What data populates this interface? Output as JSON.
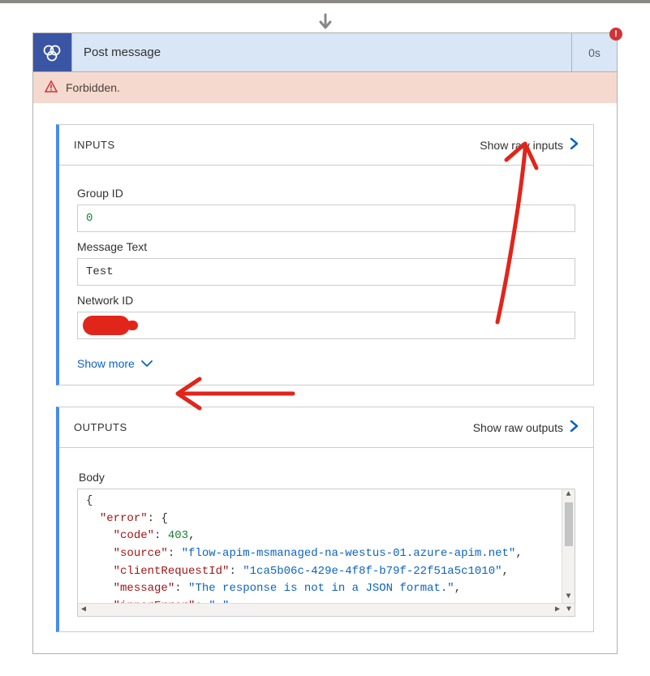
{
  "header": {
    "title": "Post message",
    "timing": "0s",
    "icon": "yammer-icon",
    "error_badge": "!"
  },
  "forbidden": {
    "text": "Forbidden."
  },
  "inputs": {
    "section_label": "INPUTS",
    "raw_link": "Show raw inputs",
    "fields": {
      "group_id": {
        "label": "Group ID",
        "value": "0"
      },
      "message_text": {
        "label": "Message Text",
        "value": "Test"
      },
      "network_id": {
        "label": "Network ID",
        "value": ""
      }
    },
    "show_more": "Show more"
  },
  "outputs": {
    "section_label": "OUTPUTS",
    "raw_link": "Show raw outputs",
    "body_label": "Body",
    "body_json": {
      "error": {
        "code": 403,
        "source": "flow-apim-msmanaged-na-westus-01.azure-apim.net",
        "clientRequestId": "1ca5b06c-429e-4f8f-b79f-22f51a5c1010",
        "message": "The response is not in a JSON format.",
        "innerError": " "
      }
    }
  }
}
